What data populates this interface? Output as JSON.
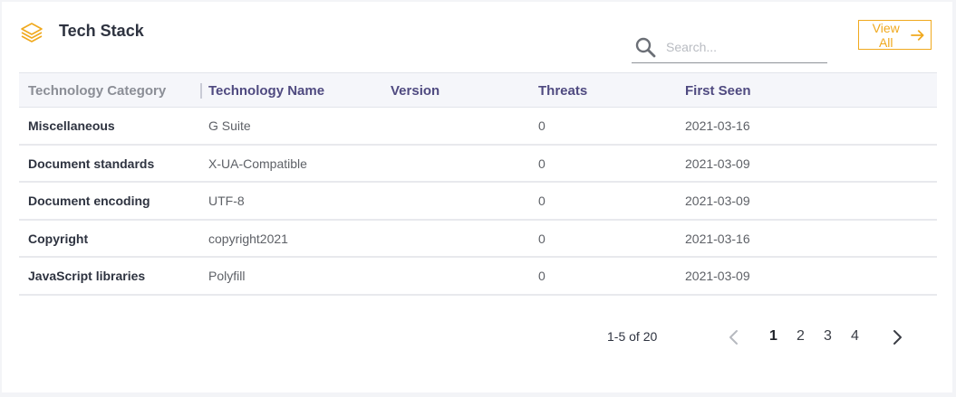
{
  "header": {
    "title": "Tech Stack",
    "view_all_label": "View All"
  },
  "search": {
    "placeholder": "Search...",
    "value": ""
  },
  "table": {
    "columns": [
      "Technology Category",
      "Technology Name",
      "Version",
      "Threats",
      "First Seen"
    ],
    "rows": [
      {
        "category": "Miscellaneous",
        "name": "G Suite",
        "version": "",
        "threats": "0",
        "first_seen": "2021-03-16"
      },
      {
        "category": "Document standards",
        "name": "X-UA-Compatible",
        "version": "",
        "threats": "0",
        "first_seen": "2021-03-09"
      },
      {
        "category": "Document encoding",
        "name": "UTF-8",
        "version": "",
        "threats": "0",
        "first_seen": "2021-03-09"
      },
      {
        "category": "Copyright",
        "name": "copyright2021",
        "version": "",
        "threats": "0",
        "first_seen": "2021-03-16"
      },
      {
        "category": "JavaScript libraries",
        "name": "Polyfill",
        "version": "",
        "threats": "0",
        "first_seen": "2021-03-09"
      }
    ]
  },
  "pagination": {
    "range_text": "1-5 of 20",
    "pages": [
      "1",
      "2",
      "3",
      "4"
    ],
    "current_page": "1"
  },
  "colors": {
    "accent": "#f0a91e",
    "header_text": "#4f4a80"
  },
  "icons": {
    "logo": "layers-icon",
    "search": "search-icon",
    "view_all": "arrow-right-icon",
    "prev": "chevron-left-icon",
    "next": "chevron-right-icon"
  }
}
